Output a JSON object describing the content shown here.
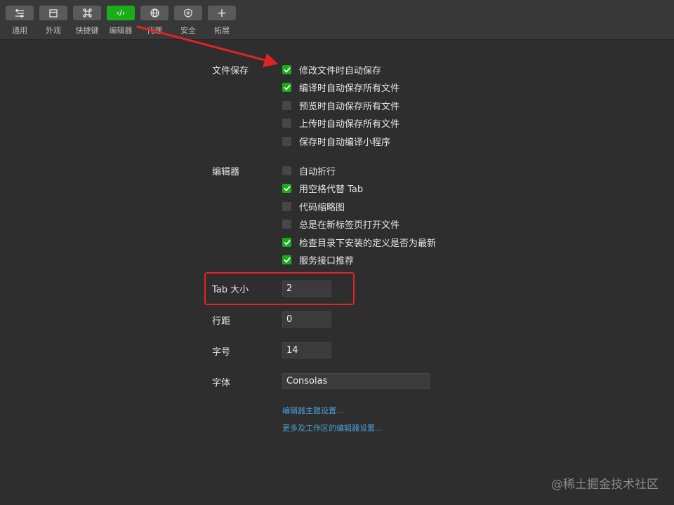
{
  "toolbar": {
    "tabs": [
      {
        "label": "通用",
        "icon": "list-settings-icon"
      },
      {
        "label": "外观",
        "icon": "window-icon"
      },
      {
        "label": "快捷键",
        "icon": "command-key-icon"
      },
      {
        "label": "编辑器",
        "icon": "code-icon",
        "glyph": "‹/›"
      },
      {
        "label": "代理",
        "icon": "globe-icon"
      },
      {
        "label": "安全",
        "icon": "shield-icon"
      },
      {
        "label": "拓展",
        "icon": "plus-icon",
        "glyph": "+"
      }
    ],
    "active_tab": "编辑器",
    "active_color": "#1aad19"
  },
  "file_save": {
    "label": "文件保存",
    "options": [
      {
        "label": "修改文件时自动保存",
        "checked": true
      },
      {
        "label": "编译时自动保存所有文件",
        "checked": true
      },
      {
        "label": "预览时自动保存所有文件",
        "checked": false
      },
      {
        "label": "上传时自动保存所有文件",
        "checked": false
      },
      {
        "label": "保存时自动编译小程序",
        "checked": false
      }
    ]
  },
  "editor": {
    "label": "编辑器",
    "options": [
      {
        "label": "自动折行",
        "checked": false
      },
      {
        "label": "用空格代替 Tab",
        "checked": true
      },
      {
        "label": "代码缩略图",
        "checked": false
      },
      {
        "label": "总是在新标签页打开文件",
        "checked": false
      },
      {
        "label": "检查目录下安装的定义是否为最新",
        "checked": true
      },
      {
        "label": "服务接口推荐",
        "checked": true
      }
    ]
  },
  "tab_size": {
    "label": "Tab 大小",
    "value": "2"
  },
  "line_height": {
    "label": "行距",
    "value": "0"
  },
  "font_size": {
    "label": "字号",
    "value": "14"
  },
  "font_family": {
    "label": "字体",
    "value": "Consolas"
  },
  "links": {
    "theme_settings": "编辑器主题设置...",
    "more_settings": "更多及工作区的编辑器设置..."
  },
  "annotation_color": "#e02424",
  "watermark": "@稀土掘金技术社区"
}
